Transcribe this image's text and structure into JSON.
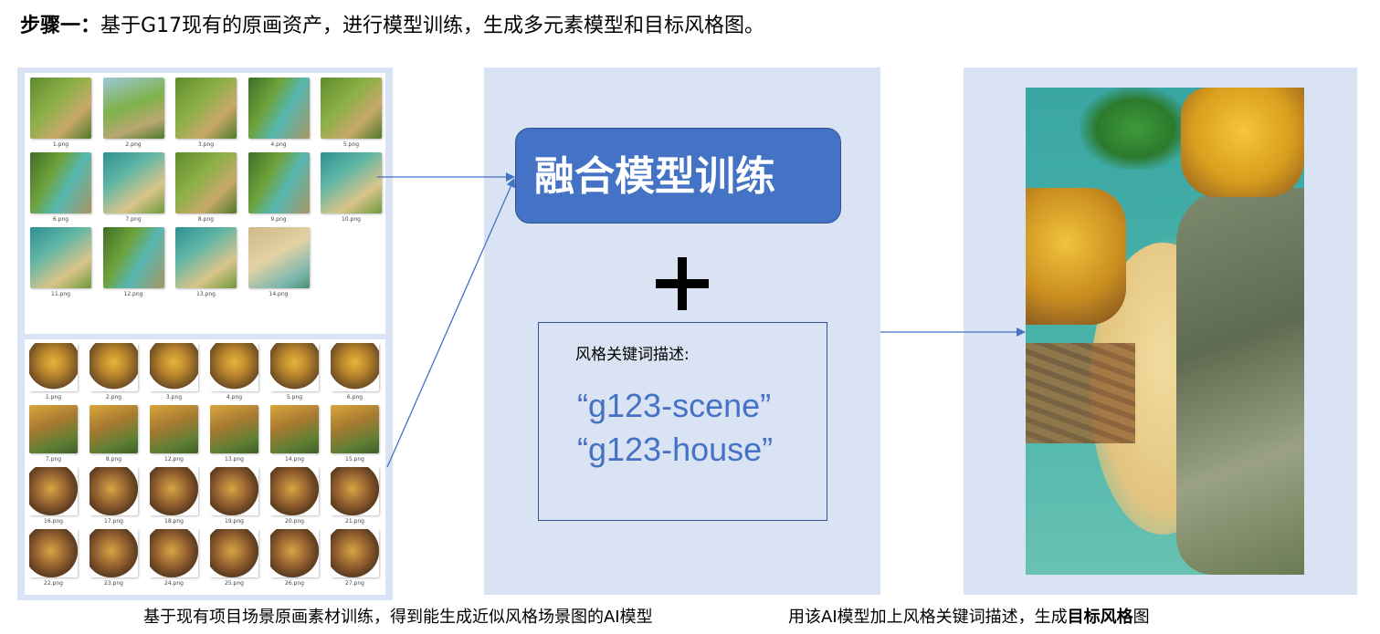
{
  "title": {
    "step_label": "步骤一：",
    "text": "基于G17现有的原画资产，进行模型训练，生成多元素模型和目标风格图。"
  },
  "scene_assets": [
    {
      "label": "1.png",
      "style": "scene-a"
    },
    {
      "label": "2.png",
      "style": "scene-b"
    },
    {
      "label": "3.png",
      "style": "scene-a"
    },
    {
      "label": "4.png",
      "style": "scene-c"
    },
    {
      "label": "5.png",
      "style": "scene-a"
    },
    {
      "label": "6.png",
      "style": "scene-c"
    },
    {
      "label": "7.png",
      "style": "scene-d"
    },
    {
      "label": "8.png",
      "style": "scene-a"
    },
    {
      "label": "9.png",
      "style": "scene-c"
    },
    {
      "label": "10.png",
      "style": "scene-d"
    },
    {
      "label": "11.png",
      "style": "scene-d"
    },
    {
      "label": "12.png",
      "style": "scene-c"
    },
    {
      "label": "13.png",
      "style": "scene-d"
    },
    {
      "label": "14.png",
      "style": "scene-e"
    }
  ],
  "house_assets": [
    {
      "label": "1.png",
      "style": "house-a"
    },
    {
      "label": "2.png",
      "style": "house-a"
    },
    {
      "label": "3.png",
      "style": "house-a"
    },
    {
      "label": "4.png",
      "style": "house-a"
    },
    {
      "label": "5.png",
      "style": "house-a"
    },
    {
      "label": "6.png",
      "style": "house-a"
    },
    {
      "label": "7.png",
      "style": "house-b"
    },
    {
      "label": "8.png",
      "style": "house-b"
    },
    {
      "label": "12.png",
      "style": "house-b"
    },
    {
      "label": "13.png",
      "style": "house-b"
    },
    {
      "label": "14.png",
      "style": "house-b"
    },
    {
      "label": "15.png",
      "style": "house-b"
    },
    {
      "label": "16.png",
      "style": "house-c"
    },
    {
      "label": "17.png",
      "style": "house-c"
    },
    {
      "label": "18.png",
      "style": "house-c"
    },
    {
      "label": "19.png",
      "style": "house-c"
    },
    {
      "label": "20.png",
      "style": "house-c"
    },
    {
      "label": "21.png",
      "style": "house-c"
    },
    {
      "label": "22.png",
      "style": "house-c"
    },
    {
      "label": "23.png",
      "style": "house-c"
    },
    {
      "label": "24.png",
      "style": "house-c"
    },
    {
      "label": "25.png",
      "style": "house-c"
    },
    {
      "label": "26.png",
      "style": "house-c"
    },
    {
      "label": "27.png",
      "style": "house-c"
    }
  ],
  "training_box": {
    "label": "融合模型训练"
  },
  "plus_symbol": "plus-icon",
  "keywords": {
    "label": "风格关键词描述:",
    "lines": [
      "“g123-scene”",
      "“g123-house”"
    ]
  },
  "captions": {
    "left": "基于现有项目场景原画素材训练，得到能生成近似风格场景图的AI模型",
    "right_prefix": "用该AI模型加上风格关键词描述，生成",
    "right_bold": "目标风格",
    "right_suffix": "图"
  },
  "colors": {
    "panel_bg": "#dae3f3",
    "accent": "#4472c4",
    "border": "#2f528f"
  }
}
